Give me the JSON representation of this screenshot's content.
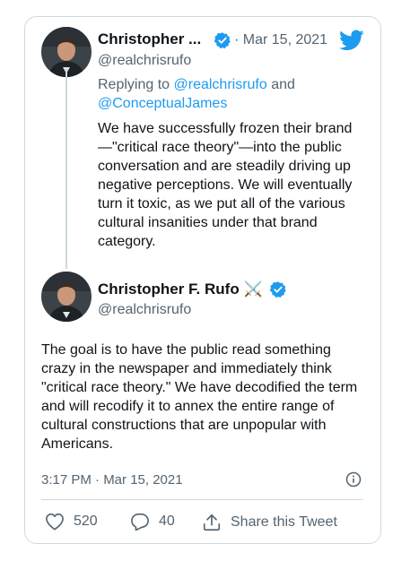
{
  "tweet1": {
    "name": "Christopher ...",
    "date": "· Mar 15, 2021",
    "handle": "@realchrisrufo",
    "reply_prefix": "Replying to",
    "reply_to_1": "@realchrisrufo",
    "reply_and": "and",
    "reply_to_2": "@ConceptualJames",
    "text": "We have successfully frozen their brand—\"critical race theory\"—into the public conversation and are steadily driving up negative perceptions. We will eventually turn it toxic, as we put all of the various cultural insanities under that brand category."
  },
  "tweet2": {
    "name": "Christopher F. Rufo",
    "name_emoji": "⚔️",
    "handle": "@realchrisrufo",
    "text": "The goal is to have the public read something crazy in the newspaper and immediately think \"critical race theory.\" We have decodified the term and will recodify it to annex the entire range of cultural constructions that are unpopular with Americans.",
    "timestamp": "3:17 PM · Mar 15, 2021"
  },
  "actions": {
    "likes": "520",
    "replies": "40",
    "share": "Share this Tweet"
  },
  "colors": {
    "twitter_blue": "#1d9bf0",
    "secondary_text": "#536471",
    "border": "#cfd9de"
  },
  "icons": [
    "twitter-bird-icon",
    "verified-badge-icon",
    "info-icon",
    "heart-icon",
    "reply-icon",
    "share-icon"
  ]
}
